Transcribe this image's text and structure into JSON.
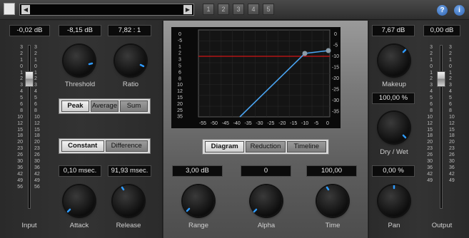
{
  "toolbar": {
    "slots": [
      "1",
      "2",
      "3",
      "4",
      "5"
    ],
    "help_label": "?",
    "info_label": "i",
    "left_arrow": "◀",
    "right_arrow": "▶"
  },
  "left": {
    "input_value": "-0,02 dB",
    "threshold_value": "-8,15 dB",
    "ratio_value": "7,82 : 1",
    "threshold_label": "Threshold",
    "ratio_label": "Ratio",
    "detection": [
      "Peak",
      "Average",
      "Sum"
    ],
    "detection_active": 0,
    "mode": [
      "Constant",
      "Difference"
    ],
    "mode_active": 0,
    "attack_value": "0,10 msec.",
    "release_value": "91,93 msec.",
    "attack_label": "Attack",
    "release_label": "Release",
    "input_label": "Input",
    "input_fader_level": "0"
  },
  "center": {
    "graph": {
      "y_left": [
        "0",
        "-5",
        "1",
        "2",
        "3",
        "5",
        "6",
        "8",
        "10",
        "12",
        "15",
        "20",
        "25",
        "35"
      ],
      "y_right": [
        "0",
        "-5",
        "-10",
        "-15",
        "-20",
        "-25",
        "-30",
        "-35"
      ],
      "x": [
        "-55",
        "-50",
        "-45",
        "-40",
        "-35",
        "-30",
        "-25",
        "-20",
        "-15",
        "-10",
        "-5",
        "0"
      ]
    },
    "view_tabs": [
      "Diagram",
      "Reduction",
      "Timeline"
    ],
    "view_active": 0,
    "range_value": "3,00 dB",
    "alpha_value": "0",
    "time_value": "100,00",
    "range_label": "Range",
    "alpha_label": "Alpha",
    "time_label": "Time"
  },
  "right": {
    "makeup_value": "7,67 dB",
    "output_value": "0,00 dB",
    "makeup_label": "Makeup",
    "drywet_value": "100,00 %",
    "drywet_label": "Dry / Wet",
    "pan_value": "0,00 %",
    "pan_label": "Pan",
    "output_label": "Output"
  },
  "meter_scale": [
    "3",
    "2",
    "1",
    "0",
    "1",
    "2",
    "3",
    "4",
    "5",
    "6",
    "8",
    "10",
    "12",
    "15",
    "18",
    "20",
    "23",
    "26",
    "30",
    "36",
    "42",
    "49",
    "56"
  ],
  "right_meter_scale": [
    "3",
    "2",
    "1",
    "0",
    "1",
    "2",
    "3",
    "4",
    "5",
    "6",
    "8",
    "10",
    "12",
    "15",
    "18",
    "20",
    "23",
    "26",
    "30",
    "36",
    "42",
    "49"
  ],
  "colors": {
    "knob_indicator": "#2f9bff",
    "threshold_line": "#d01515",
    "curve": "#4aa3f0",
    "curve_point": "#8c9ca8"
  }
}
